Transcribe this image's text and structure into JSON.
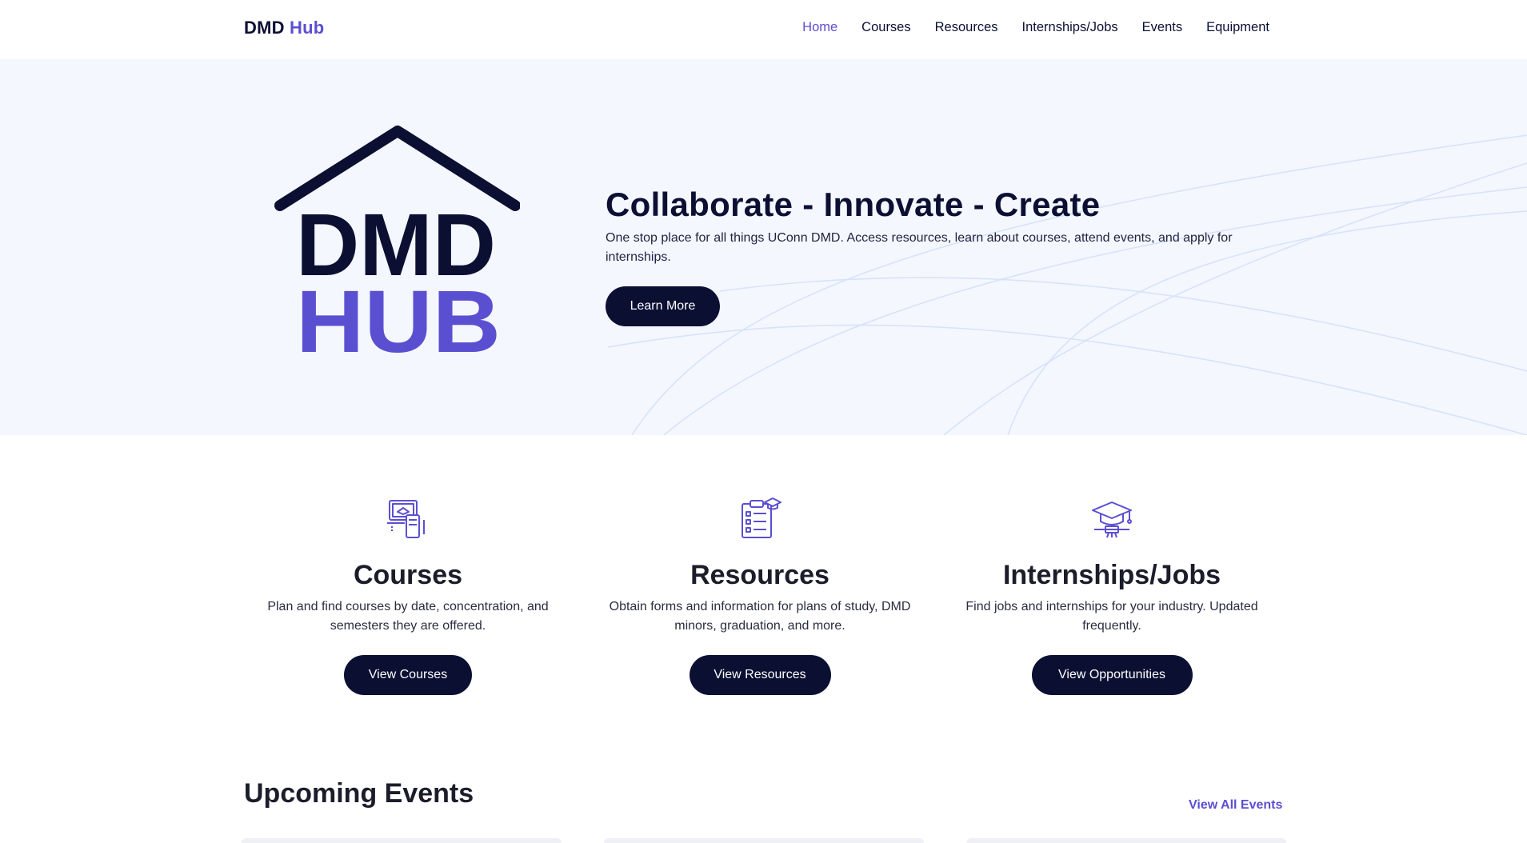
{
  "header": {
    "brand_part1": "DMD",
    "brand_part2": "Hub",
    "nav": [
      {
        "label": "Home",
        "active": true
      },
      {
        "label": "Courses",
        "active": false
      },
      {
        "label": "Resources",
        "active": false
      },
      {
        "label": "Internships/Jobs",
        "active": false
      },
      {
        "label": "Events",
        "active": false
      },
      {
        "label": "Equipment",
        "active": false
      }
    ]
  },
  "hero": {
    "logo_line1": "DMD",
    "logo_line2": "HUB",
    "title": "Collaborate - Innovate - Create",
    "text": "One stop place for all things UConn DMD. Access resources, learn about courses, attend events, and apply for internships.",
    "button_label": "Learn More"
  },
  "features": [
    {
      "icon": "laptop-tablet-icon",
      "title": "Courses",
      "text": "Plan and find courses by date, concentration, and semesters they are offered.",
      "button_label": "View Courses"
    },
    {
      "icon": "clipboard-graduation-icon",
      "title": "Resources",
      "text": "Obtain forms and information for plans of study, DMD minors, graduation, and more.",
      "button_label": "View Resources"
    },
    {
      "icon": "graduation-cap-icon",
      "title": "Internships/Jobs",
      "text": "Find jobs and internships for your industry. Updated frequently.",
      "button_label": "View Opportunities"
    }
  ],
  "events": {
    "title": "Upcoming Events",
    "view_all_label": "View All Events"
  },
  "colors": {
    "accent": "#5b4fd1",
    "dark": "#0b1033",
    "hero_bg": "#f4f7fe"
  }
}
